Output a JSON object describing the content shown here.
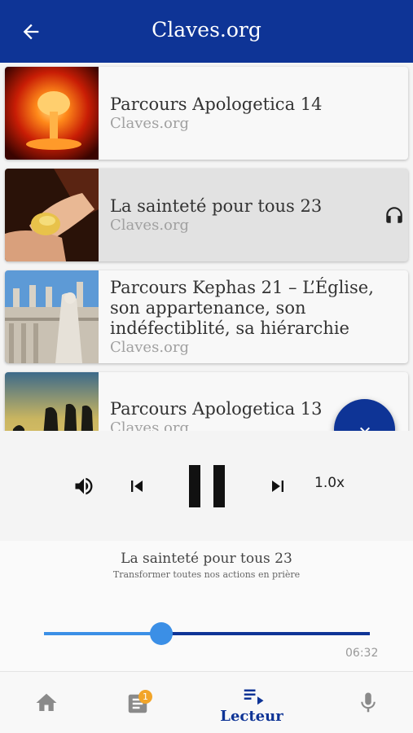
{
  "app": {
    "title": "Claves.org"
  },
  "list": {
    "items": [
      {
        "title": "Parcours Apologetica 14",
        "source": "Claves.org",
        "thumb": "nuclear-explosion-image"
      },
      {
        "title": "La sainteté pour tous 23",
        "source": "Claves.org",
        "thumb": "hands-holding-bread-image",
        "active": true,
        "icon": "headphones-icon"
      },
      {
        "title": "Parcours Kephas 21 – L’Église, son appartenance, son indéfectiblité, sa hiérarchie",
        "source": "Claves.org",
        "thumb": "basilica-statues-image"
      },
      {
        "title": "Parcours Apologetica 13",
        "source": "Claves.org",
        "thumb": "silhouettes-sunset-image"
      }
    ]
  },
  "player": {
    "speed": "1.0x",
    "now_playing_title": "La sainteté pour tous 23",
    "now_playing_subtitle": "Transformer toutes nos actions en prière",
    "remaining_time": "06:32",
    "progress": 0.36
  },
  "bottom_nav": {
    "items": [
      {
        "icon": "home-icon"
      },
      {
        "icon": "article-icon",
        "badge": "1"
      },
      {
        "icon": "playlist-play-icon",
        "label": "Lecteur",
        "selected": true
      },
      {
        "icon": "microphone-icon"
      }
    ]
  },
  "colors": {
    "primary": "#0e3496",
    "accent": "#3b8fe6",
    "badge": "#f2a529"
  }
}
